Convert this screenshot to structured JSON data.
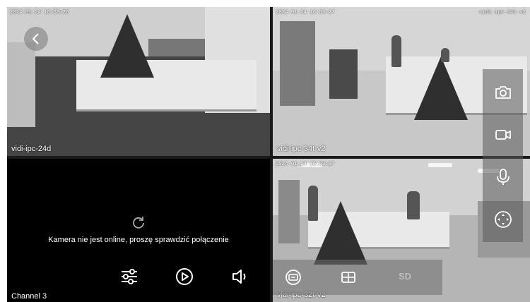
{
  "cameras": [
    {
      "timestamp": "2024-01-24 16:53:26",
      "name": "vidi-ipc-24d"
    },
    {
      "timestamp": "2024-01-24 16:53:27",
      "name": "vidi-ipc-34t-v2",
      "overlay": "vidi-ipc-34t-v2"
    },
    {
      "name": "Channel 3",
      "offline_message": "Kamera nie jest online, proszę sprawdzić połączenie"
    },
    {
      "timestamp": "2024-01-24 16:53:27",
      "name": "vidi-ipc-32t-v2"
    }
  ],
  "bottom_bar": {
    "sd_label": "SD"
  },
  "icons": {
    "back": "chevron-left-icon",
    "refresh": "refresh-icon",
    "settings": "sliders-icon",
    "playback": "play-circle-icon",
    "speaker": "speaker-icon",
    "snapshot": "camera-icon",
    "record": "video-camera-icon",
    "microphone": "microphone-icon",
    "ptz": "ptz-control-icon",
    "stream": "stream-quality-icon",
    "layout": "grid-layout-icon"
  }
}
